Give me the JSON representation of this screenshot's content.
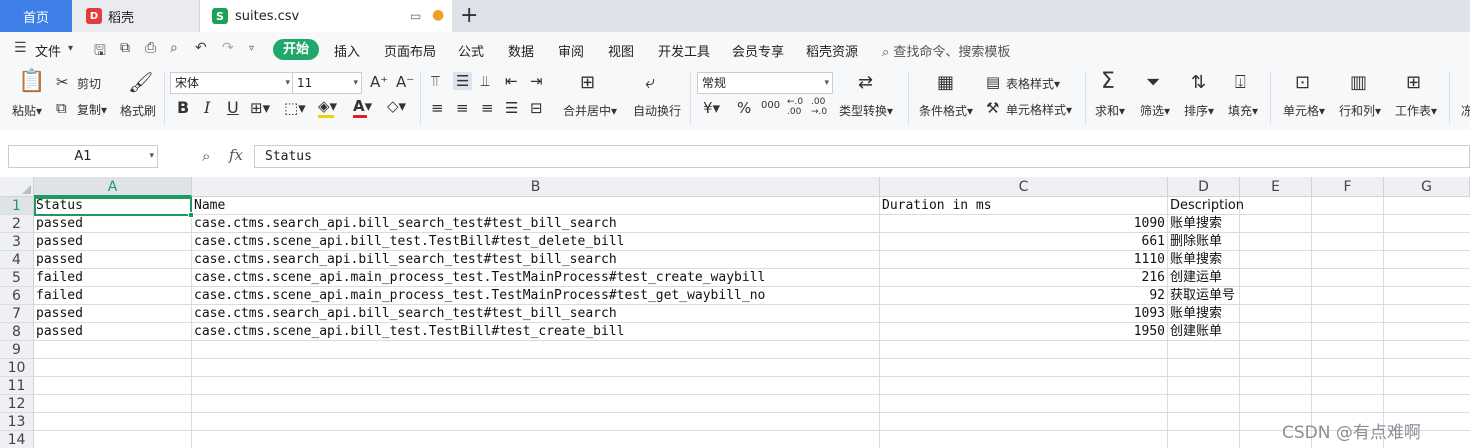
{
  "tabs": {
    "home": "首页",
    "doc": "稻壳",
    "file": "suites.csv",
    "add": "+"
  },
  "menu": {
    "file": "文件",
    "items": [
      "开始",
      "插入",
      "页面布局",
      "公式",
      "数据",
      "审阅",
      "视图",
      "开发工具",
      "会员专享",
      "稻壳资源"
    ],
    "search": "查找命令、搜索模板"
  },
  "ribbon": {
    "paste": "粘贴",
    "cut": "剪切",
    "copy": "复制",
    "format_painter": "格式刷",
    "font_name": "宋体",
    "font_size": "11",
    "bold": "B",
    "italic": "I",
    "underline": "U",
    "merge_center": "合并居中",
    "wrap_text": "自动换行",
    "number_format": "常规",
    "currency": "¥",
    "percent": "%",
    "thousands": "000",
    "type_convert": "类型转换",
    "cond_format": "条件格式",
    "table_style": "表格样式",
    "cell_style": "单元格样式",
    "sum": "求和",
    "filter": "筛选",
    "sort": "排序",
    "fill": "填充",
    "cells": "单元格",
    "rows_cols": "行和列",
    "worksheet": "工作表",
    "truncated": "冻"
  },
  "formula_bar": {
    "name_box": "A1",
    "fx": "fx",
    "content": "Status"
  },
  "columns": [
    "A",
    "B",
    "C",
    "D",
    "E",
    "F",
    "G"
  ],
  "rows": [
    "1",
    "2",
    "3",
    "4",
    "5",
    "6",
    "7",
    "8",
    "9",
    "10",
    "11",
    "12",
    "13",
    "14"
  ],
  "sheet": [
    [
      "Status",
      "Name",
      "Duration in ms",
      "Description"
    ],
    [
      "passed",
      "case.ctms.search_api.bill_search_test#test_bill_search",
      "1090",
      "账单搜索"
    ],
    [
      "passed",
      "case.ctms.scene_api.bill_test.TestBill#test_delete_bill",
      "661",
      "删除账单"
    ],
    [
      "passed",
      "case.ctms.search_api.bill_search_test#test_bill_search",
      "1110",
      "账单搜索"
    ],
    [
      "failed",
      "case.ctms.scene_api.main_process_test.TestMainProcess#test_create_waybill",
      "216",
      "创建运单"
    ],
    [
      "failed",
      "case.ctms.scene_api.main_process_test.TestMainProcess#test_get_waybill_no",
      "92",
      "获取运单号"
    ],
    [
      "passed",
      "case.ctms.search_api.bill_search_test#test_bill_search",
      "1093",
      "账单搜索"
    ],
    [
      "passed",
      "case.ctms.scene_api.bill_test.TestBill#test_create_bill",
      "1950",
      "创建账单"
    ]
  ],
  "watermark": "CSDN @有点难啊",
  "colors": {
    "accent_green": "#1f9a5e",
    "home_tab_blue": "#3f7fe8"
  }
}
